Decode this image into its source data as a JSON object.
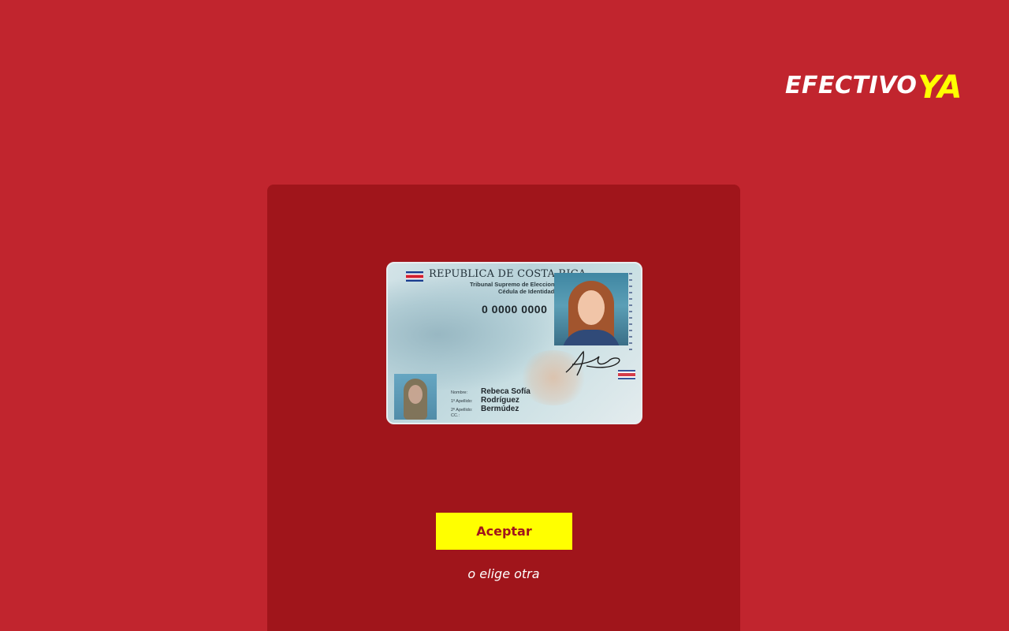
{
  "brand": {
    "logo_word": "EFECTIVO",
    "logo_accent": "YA",
    "colors": {
      "background": "#c1252e",
      "panel": "#a0151b",
      "accent": "#ffff00",
      "text_light": "#ffffff"
    }
  },
  "id_card": {
    "country": "REPUBLICA DE COSTA RICA",
    "issuer": "Tribunal Supremo de Elecciones",
    "doc_type": "Cédula de Identidad",
    "number": "0 0000 0000",
    "fields": [
      {
        "label": "Nombre:",
        "value": "Rebeca Sofía"
      },
      {
        "label": "1º Apellido:",
        "value": "Rodríguez"
      },
      {
        "label": "2º Apellido:",
        "value": "Bermúdez"
      },
      {
        "label": "CC.:",
        "value": ""
      }
    ]
  },
  "actions": {
    "accept_label": "Aceptar",
    "other_label": "o elige otra"
  }
}
